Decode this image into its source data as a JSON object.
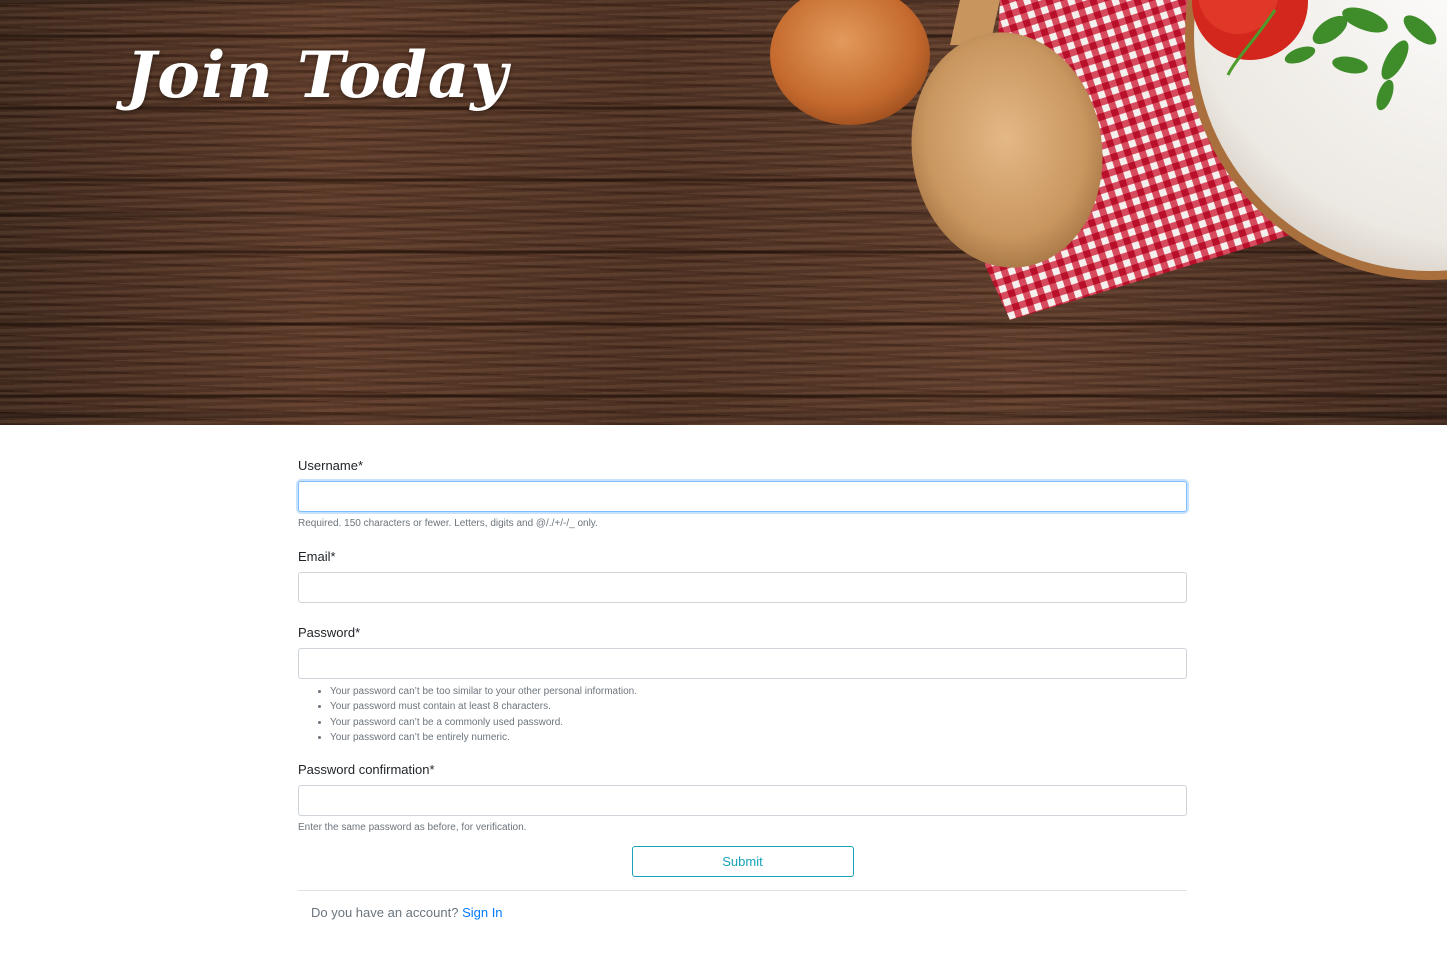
{
  "hero": {
    "title": "Join Today"
  },
  "form": {
    "username": {
      "label": "Username*",
      "value": "",
      "help": "Required. 150 characters or fewer. Letters, digits and @/./+/-/_ only."
    },
    "email": {
      "label": "Email*",
      "value": ""
    },
    "password": {
      "label": "Password*",
      "value": "",
      "help_items": [
        "Your password can’t be too similar to your other personal information.",
        "Your password must contain at least 8 characters.",
        "Your password can’t be a commonly used password.",
        "Your password can’t be entirely numeric."
      ]
    },
    "password_confirmation": {
      "label": "Password confirmation*",
      "value": "",
      "help": "Enter the same password as before, for verification."
    },
    "submit_label": "Submit"
  },
  "footer": {
    "question": "Do you have an account?",
    "signin_label": "Sign In"
  },
  "colors": {
    "accent": "#17a2b8",
    "link": "#007bff",
    "focus": "#80bdff"
  }
}
